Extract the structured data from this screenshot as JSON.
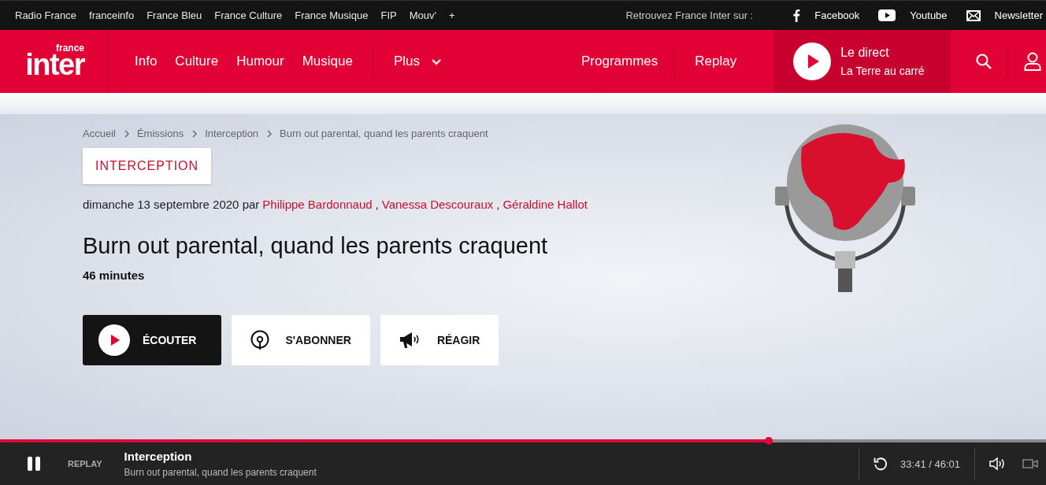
{
  "network_bar": {
    "stations": [
      "Radio France",
      "franceinfo",
      "France Bleu",
      "France Culture",
      "France Musique",
      "FIP",
      "Mouv'",
      "+"
    ],
    "follow_label": "Retrouvez France Inter sur :",
    "socials": [
      {
        "kind": "facebook",
        "label": "Facebook"
      },
      {
        "kind": "youtube",
        "label": "Youtube"
      },
      {
        "kind": "newsletter",
        "label": "Newsletter"
      }
    ]
  },
  "header": {
    "logo": {
      "small": "france",
      "big": "inter"
    },
    "nav": [
      {
        "label": "Info"
      },
      {
        "label": "Culture"
      },
      {
        "label": "Humour"
      },
      {
        "label": "Musique"
      }
    ],
    "more": "Plus",
    "nav_right": [
      "Programmes",
      "Replay"
    ],
    "live": {
      "title": "Le direct",
      "subtitle": "La Terre au carré"
    }
  },
  "breadcrumb": [
    "Accueil",
    "Émissions",
    "Interception",
    "Burn out parental, quand les parents craquent"
  ],
  "show_tag": "INTERCEPTION",
  "byline": {
    "date": "dimanche 13 septembre 2020 par",
    "authors": [
      "Philippe Bardonnaud",
      "Vanessa Descouraux",
      "Géraldine Hallot"
    ],
    "separator": ","
  },
  "title": "Burn out parental, quand les parents craquent",
  "duration": "46 minutes",
  "actions": [
    {
      "kind": "listen",
      "label": "ÉCOUTER"
    },
    {
      "kind": "subscribe",
      "label": "S'ABONNER"
    },
    {
      "kind": "react",
      "label": "RÉAGIR"
    }
  ],
  "player": {
    "level": 0.735,
    "mode": "REPLAY",
    "show": "Interception",
    "episode": "Burn out parental, quand les parents craquent",
    "time": "33:41 / 46:01",
    "playing": true
  }
}
